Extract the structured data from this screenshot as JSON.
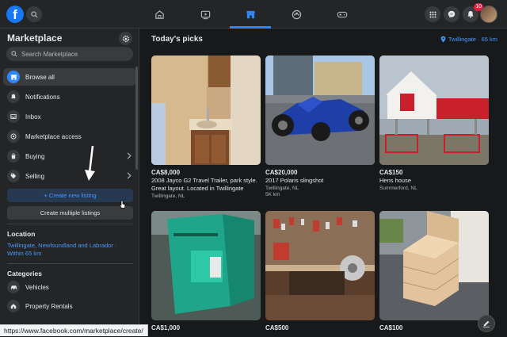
{
  "topbar": {
    "logo": "f",
    "notifications_badge": "10",
    "tabs": [
      {
        "name": "home",
        "icon": "home-icon"
      },
      {
        "name": "watch",
        "icon": "video-icon"
      },
      {
        "name": "marketplace",
        "icon": "store-icon",
        "active": true
      },
      {
        "name": "groups",
        "icon": "groups-icon"
      },
      {
        "name": "gaming",
        "icon": "gaming-icon"
      }
    ]
  },
  "sidebar": {
    "title": "Marketplace",
    "search_placeholder": "Search Marketplace",
    "items": [
      {
        "label": "Browse all",
        "icon": "store-icon",
        "active": true
      },
      {
        "label": "Notifications",
        "icon": "bell-icon"
      },
      {
        "label": "Inbox",
        "icon": "inbox-icon"
      },
      {
        "label": "Marketplace access",
        "icon": "access-icon"
      },
      {
        "label": "Buying",
        "icon": "bag-icon",
        "chevron": true
      },
      {
        "label": "Selling",
        "icon": "tag-icon",
        "chevron": true
      }
    ],
    "create_listing": "+ Create new listing",
    "create_multiple": "Create multiple listings",
    "location_heading": "Location",
    "location_value": "Twillingate, Newfoundland and Labrador · Within 65 km",
    "categories_heading": "Categories",
    "categories": [
      {
        "label": "Vehicles",
        "icon": "car-icon"
      },
      {
        "label": "Property Rentals",
        "icon": "house-icon"
      }
    ]
  },
  "main": {
    "title": "Today's picks",
    "location": "Twillingate · 65 km",
    "listings": [
      {
        "price": "CA$8,000",
        "title": "2008 Jayco G2 Travel Trailer, park style. Great layout. Located in Twillingate",
        "location": "Twillingate, NL"
      },
      {
        "price": "CA$20,000",
        "title": "2017 Polaris slingshot",
        "location": "Twillingate, NL",
        "distance": "5K km"
      },
      {
        "price": "CA$150",
        "title": "Hens house",
        "location": "Summerford, NL"
      },
      {
        "price": "CA$1,000",
        "title": "",
        "location": ""
      },
      {
        "price": "CA$500",
        "title": "",
        "location": ""
      },
      {
        "price": "CA$100",
        "title": "",
        "location": ""
      }
    ]
  },
  "status_url": "https://www.facebook.com/marketplace/create/",
  "colors": {
    "accent": "#2d88ff",
    "link": "#4599ff",
    "bg": "#18191a",
    "panel": "#242526"
  }
}
